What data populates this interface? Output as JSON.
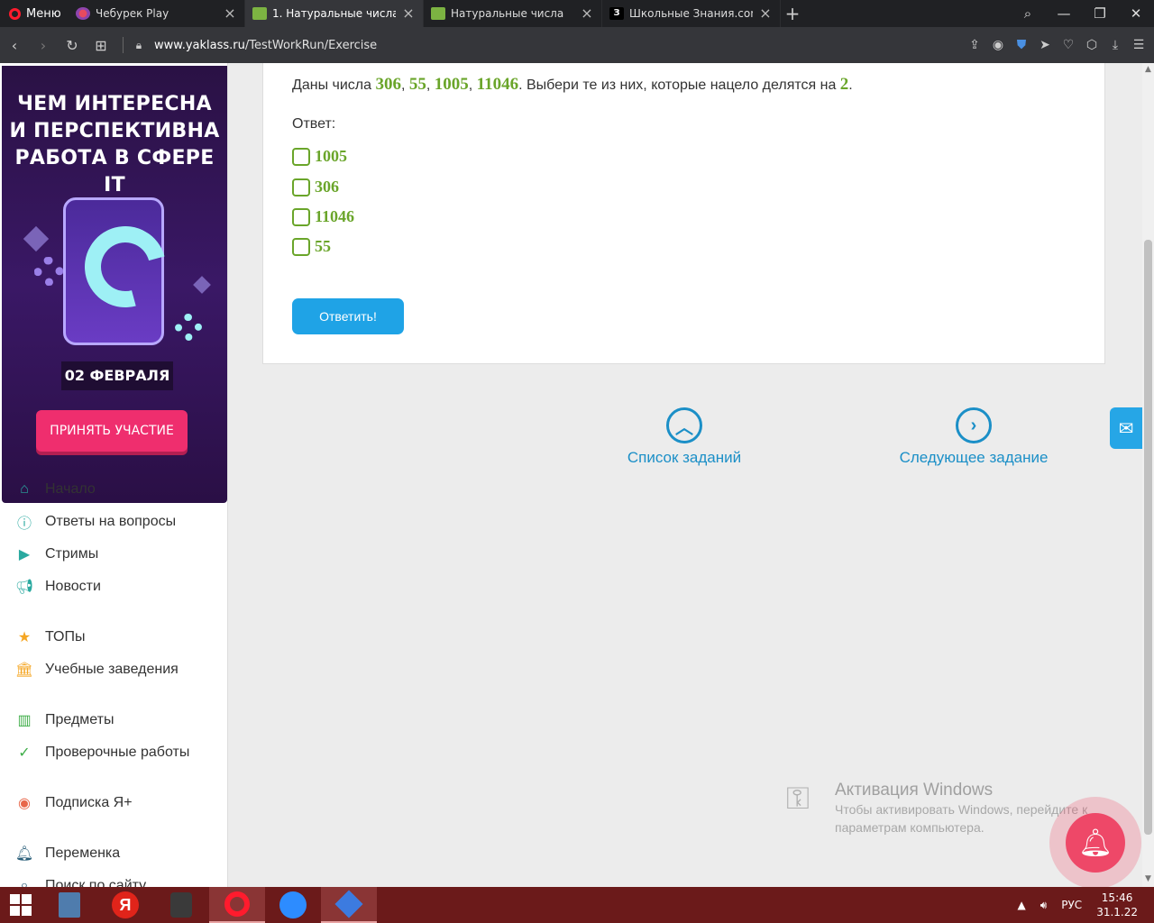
{
  "browser": {
    "menu_label": "Меню",
    "tabs": [
      {
        "title": "Чебурек Play",
        "favicon": "play-icon",
        "active": false
      },
      {
        "title": "1. Натуральные числа",
        "favicon": "book-icon",
        "active": true
      },
      {
        "title": "Натуральные числа",
        "favicon": "book-icon",
        "active": false
      },
      {
        "title": "Школьные Знания.com - Р",
        "favicon": "znania-icon",
        "active": false
      }
    ],
    "url_host": "www.yaklass.ru",
    "url_path": "/TestWorkRun/Exercise"
  },
  "banner": {
    "title_line1": "ЧЕМ ИНТЕРЕСНА",
    "title_line2": "И ПЕРСПЕКТИВНА",
    "title_line3": "РАБОТА В СФЕРЕ IT",
    "date": "02 ФЕВРАЛЯ",
    "cta": "ПРИНЯТЬ УЧАСТИЕ"
  },
  "sidebar": {
    "items": [
      {
        "label": "Начало",
        "icon": "home-icon"
      },
      {
        "label": "Ответы на вопросы",
        "icon": "question-icon"
      },
      {
        "label": "Стримы",
        "icon": "play-icon"
      },
      {
        "label": "Новости",
        "icon": "megaphone-icon"
      },
      {
        "label": "ТОПы",
        "icon": "star-icon"
      },
      {
        "label": "Учебные заведения",
        "icon": "institution-icon"
      },
      {
        "label": "Предметы",
        "icon": "books-icon"
      },
      {
        "label": "Проверочные работы",
        "icon": "check-circle-icon"
      },
      {
        "label": "Подписка Я+",
        "icon": "yaplus-icon"
      },
      {
        "label": "Переменка",
        "icon": "bell-icon"
      },
      {
        "label": "Поиск по сайту",
        "icon": "search-icon"
      }
    ]
  },
  "exercise": {
    "q_prefix": "Даны числа ",
    "numbers": [
      "306",
      "55",
      "1005",
      "11046"
    ],
    "comma": ", ",
    "q_middle": ". Выбери те из них, которые нацело делятся на ",
    "divisor": "2",
    "q_end": ".",
    "answer_label": "Ответ:",
    "options": [
      "1005",
      "306",
      "11046",
      "55"
    ],
    "submit_label": "Ответить!"
  },
  "footer_nav": {
    "list_label": "Список заданий",
    "next_label": "Следующее задание"
  },
  "watermark": {
    "title": "Активация Windows",
    "line1": "Чтобы активировать Windows, перейдите к",
    "line2": "параметрам компьютера."
  },
  "taskbar": {
    "lang": "РУС",
    "time": "15:46",
    "date": "31.1.22",
    "ya_label": "Я"
  },
  "colors": {
    "accent_green": "#6aa52a",
    "accent_blue": "#1fa3e6",
    "taskbar": "#6b1a1a"
  }
}
